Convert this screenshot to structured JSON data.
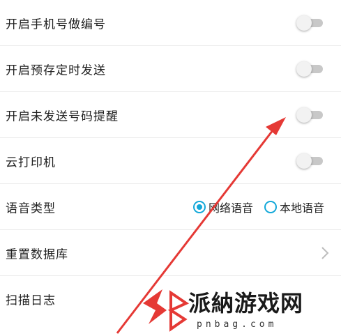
{
  "settings": [
    {
      "label": "开启手机号做编号",
      "type": "toggle",
      "on": false
    },
    {
      "label": "开启预存定时发送",
      "type": "toggle",
      "on": false
    },
    {
      "label": "开启未发送号码提醒",
      "type": "toggle",
      "on": false
    },
    {
      "label": "云打印机",
      "type": "toggle",
      "on": false
    },
    {
      "label": "语音类型",
      "type": "radio",
      "options": [
        "网络语音",
        "本地语音"
      ],
      "selected": "网络语音"
    },
    {
      "label": "重置数据库",
      "type": "link"
    },
    {
      "label": "扫描日志",
      "type": "link"
    }
  ],
  "watermark": {
    "title": "派納游戏网",
    "url": "pnbag.com"
  },
  "colors": {
    "accent": "#13a8d9",
    "arrow": "#e53935",
    "toggle_off": "#c8c8c8"
  }
}
